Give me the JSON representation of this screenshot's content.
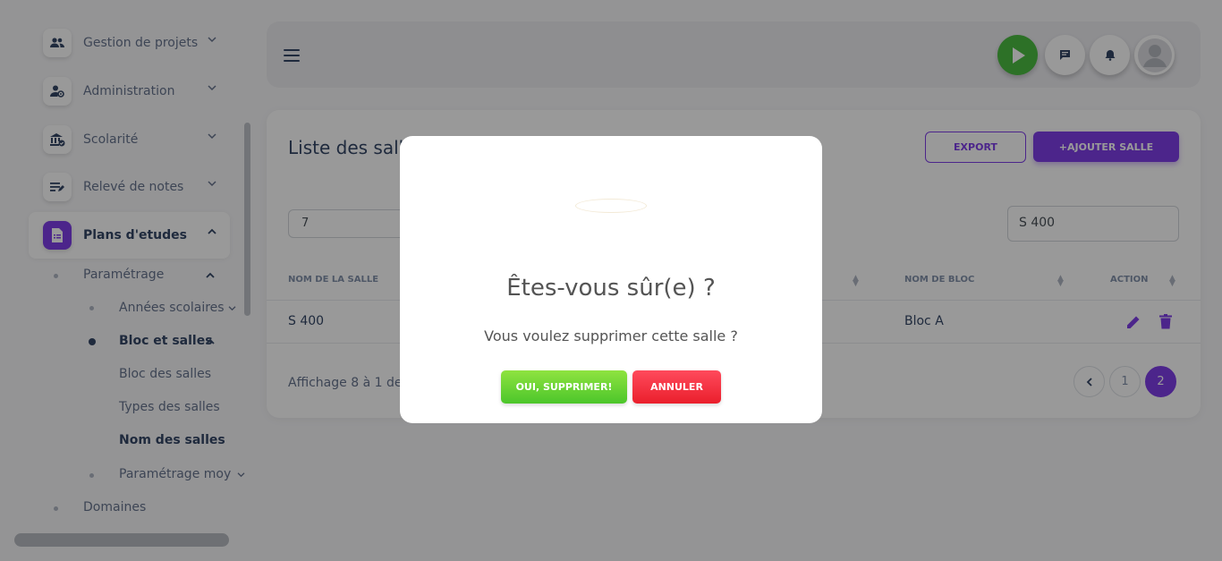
{
  "sidebar": {
    "items": [
      {
        "label": "Gestion de projets",
        "icon": "users-icon"
      },
      {
        "label": "Administration",
        "icon": "user-gear-icon"
      },
      {
        "label": "Scolarité",
        "icon": "bank-check-icon"
      },
      {
        "label": "Relevé de notes",
        "icon": "notes-edit-icon"
      },
      {
        "label": "Plans d'etudes",
        "icon": "document-icon"
      }
    ],
    "sub": {
      "parametrage": "Paramétrage",
      "annees": "Années scolaires",
      "bloc_salles": "Bloc et salles",
      "bloc_des_salles": "Bloc des salles",
      "types_des_salles": "Types des salles",
      "nom_des_salles": "Nom des salles",
      "parametrage_moy": "Paramétrage moy",
      "domaines": "Domaines"
    }
  },
  "card": {
    "title": "Liste des sall",
    "export_label": "EXPORT",
    "add_label": "+AJOUTER SALLE",
    "per_page": "7",
    "search_value": "S 400",
    "columns": [
      "NOM DE LA SALLE",
      "NOM DE BLOC",
      "ACTION"
    ],
    "row": {
      "salle": "S 400",
      "bloc": "Bloc A"
    },
    "info": "Affichage 8 à 1 de",
    "pages": [
      "1",
      "2"
    ]
  },
  "modal": {
    "title": "Êtes-vous sûr(e) ?",
    "text": "Vous voulez supprimer cette salle ?",
    "confirm_label": "OUI, SUPPRIMER!",
    "cancel_label": "ANNULER"
  },
  "colors": {
    "accent": "#7f3fe8",
    "confirm": "#4cc62b",
    "cancel": "#ea1f2c",
    "play": "#4bbc41"
  }
}
